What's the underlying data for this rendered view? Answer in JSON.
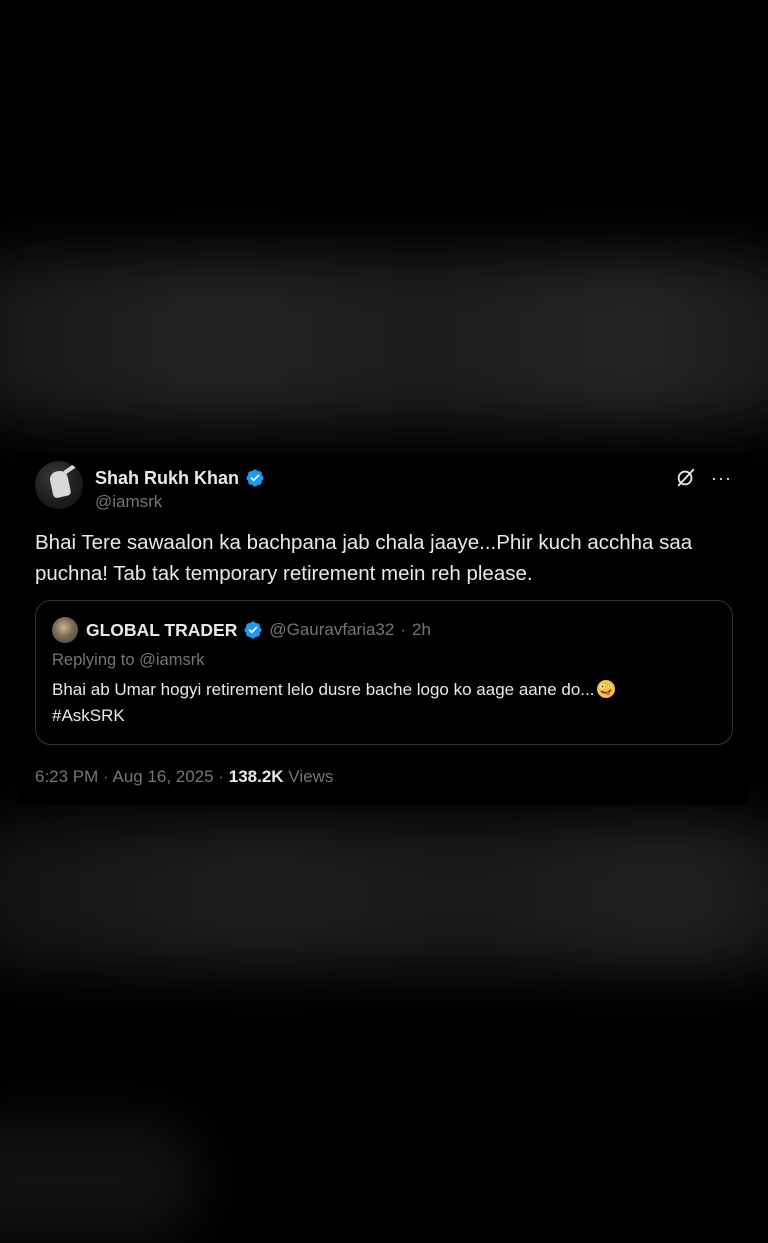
{
  "tweet": {
    "author_name": "Shah Rukh Khan",
    "author_handle": "@iamsrk",
    "text": "Bhai Tere sawaalon ka bachpana jab chala jaaye...Phir kuch acchha saa puchna! Tab tak temporary retirement mein reh please.",
    "more_icon": "···",
    "quoted": {
      "author_name": "GLOBAL TRADER",
      "author_handle": "@Gauravfaria32",
      "separator": "·",
      "time": "2h",
      "replying_to": "Replying to @iamsrk",
      "text_line1": "Bhai ab Umar hogyi retirement lelo dusre bache logo ko aage aane do...",
      "text_line2": "#AskSRK"
    },
    "meta": {
      "time": "6:23 PM",
      "sep1": " · ",
      "date": "Aug 16, 2025",
      "sep2": " · ",
      "views_count": "138.2K",
      "views_label": " Views"
    }
  },
  "icons": {
    "verified": "verified-badge-icon",
    "grok": "grok-icon",
    "more": "more-options-icon",
    "emoji": "zany-face-emoji"
  },
  "colors": {
    "background": "#000000",
    "text_primary": "#e7e9ea",
    "text_secondary": "#71767b",
    "verified_blue": "#1d9bf0",
    "border": "#2f3336"
  }
}
